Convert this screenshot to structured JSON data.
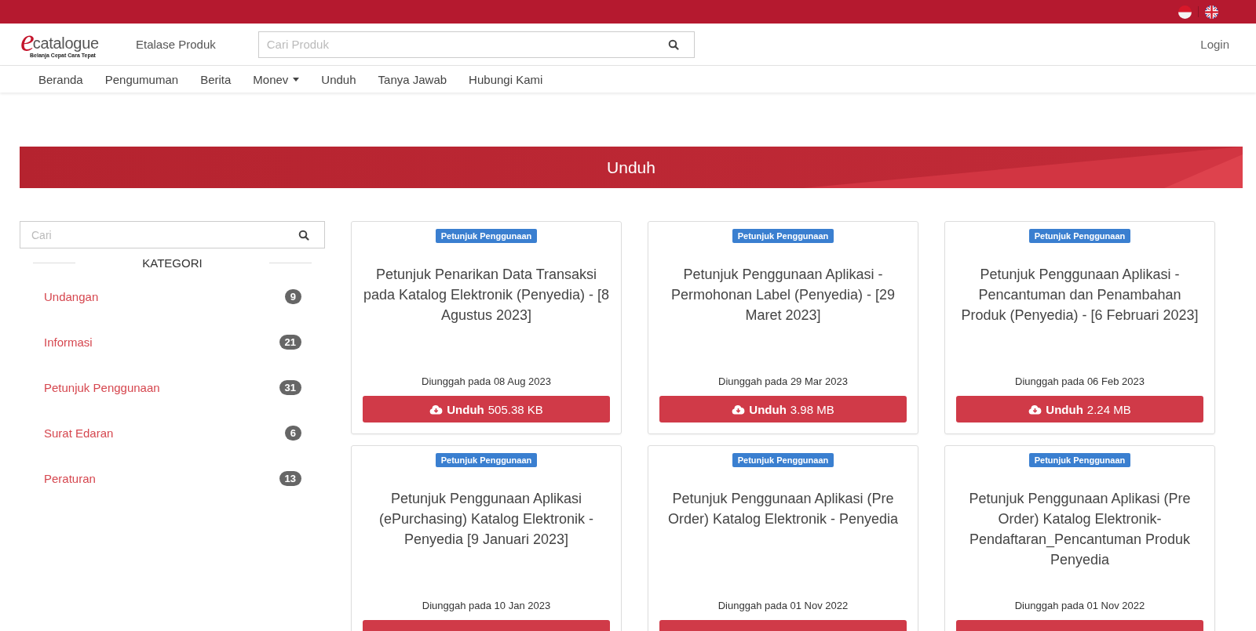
{
  "logo": {
    "letter": "e",
    "word": "catalogue",
    "tagline": "Belanja Cepat Cara Tepat"
  },
  "header": {
    "storefront_link": "Etalase Produk",
    "search": {
      "placeholder": "Cari Produk"
    },
    "login": "Login"
  },
  "nav": [
    {
      "label": "Beranda",
      "kind": "link"
    },
    {
      "label": "Pengumuman",
      "kind": "link"
    },
    {
      "label": "Berita",
      "kind": "link"
    },
    {
      "label": "Monev",
      "kind": "dropdown"
    },
    {
      "label": "Unduh",
      "kind": "link"
    },
    {
      "label": "Tanya Jawab",
      "kind": "link"
    },
    {
      "label": "Hubungi Kami",
      "kind": "link"
    }
  ],
  "banner": {
    "title": "Unduh"
  },
  "sidebar": {
    "search": {
      "placeholder": "Cari"
    },
    "heading": "KATEGORI",
    "categories": [
      {
        "label": "Undangan",
        "count": "9"
      },
      {
        "label": "Informasi",
        "count": "21"
      },
      {
        "label": "Petunjuk Penggunaan",
        "count": "31"
      },
      {
        "label": "Surat Edaran",
        "count": "6"
      },
      {
        "label": "Peraturan",
        "count": "13"
      }
    ]
  },
  "documents": [
    {
      "tag": "Petunjuk Penggunaan",
      "title": "Petunjuk Penarikan Data Transaksi pada Katalog Elektronik (Penyedia) - [8 Agustus 2023]",
      "uploaded": "Diunggah pada 08 Aug 2023",
      "button_label": "Unduh",
      "size": "505.38 KB"
    },
    {
      "tag": "Petunjuk Penggunaan",
      "title": "Petunjuk Penggunaan Aplikasi - Permohonan Label (Penyedia) - [29 Maret 2023]",
      "uploaded": "Diunggah pada 29 Mar 2023",
      "button_label": "Unduh",
      "size": "3.98 MB"
    },
    {
      "tag": "Petunjuk Penggunaan",
      "title": "Petunjuk Penggunaan Aplikasi - Pencantuman dan Penambahan Produk (Penyedia) - [6 Februari 2023]",
      "uploaded": "Diunggah pada 06 Feb 2023",
      "button_label": "Unduh",
      "size": "2.24 MB"
    },
    {
      "tag": "Petunjuk Penggunaan",
      "title": "Petunjuk Penggunaan Aplikasi (ePurchasing) Katalog Elektronik - Penyedia [9 Januari 2023]",
      "uploaded": "Diunggah pada 10 Jan 2023"
    },
    {
      "tag": "Petunjuk Penggunaan",
      "title": "Petunjuk Penggunaan Aplikasi (Pre Order) Katalog Elektronik - Penyedia",
      "uploaded": "Diunggah pada 01 Nov 2022"
    },
    {
      "tag": "Petunjuk Penggunaan",
      "title": "Petunjuk Penggunaan Aplikasi (Pre Order) Katalog Elektronik-Pendaftaran_Pencantuman Produk Penyedia",
      "uploaded": "Diunggah pada 01 Nov 2022"
    }
  ]
}
